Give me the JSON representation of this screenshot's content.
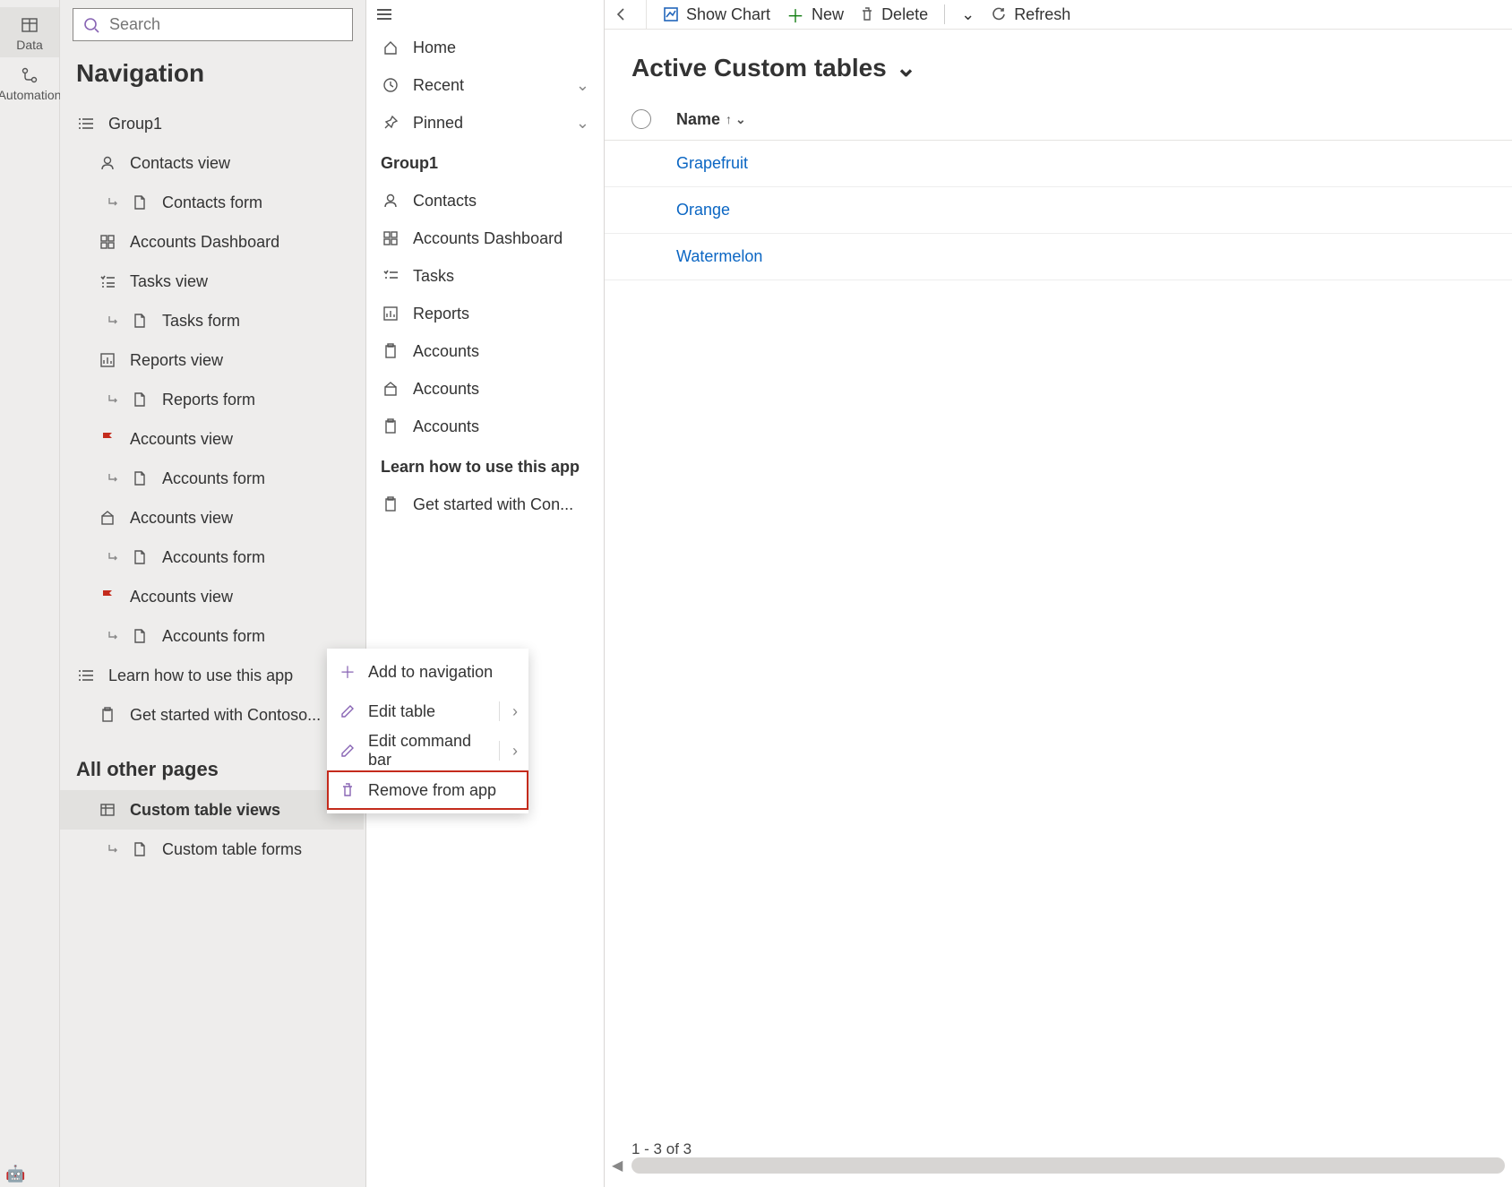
{
  "rail": {
    "data": "Data",
    "automation": "Automation"
  },
  "search": {
    "placeholder": "Search"
  },
  "nav": {
    "title": "Navigation",
    "group1": "Group1",
    "items": {
      "contacts_view": "Contacts view",
      "contacts_form": "Contacts form",
      "accounts_dashboard": "Accounts Dashboard",
      "tasks_view": "Tasks view",
      "tasks_form": "Tasks form",
      "reports_view": "Reports view",
      "reports_form": "Reports form",
      "accounts_view1": "Accounts view",
      "accounts_form1": "Accounts form",
      "accounts_view2": "Accounts view",
      "accounts_form2": "Accounts form",
      "accounts_view3": "Accounts view",
      "accounts_form3": "Accounts form"
    },
    "learn": "Learn how to use this app",
    "getstarted": "Get started with Contoso...",
    "all_other": "All other pages",
    "custom_views": "Custom table views",
    "custom_forms": "Custom table forms"
  },
  "mid": {
    "home": "Home",
    "recent": "Recent",
    "pinned": "Pinned",
    "group1": "Group1",
    "contacts": "Contacts",
    "accounts_dashboard": "Accounts Dashboard",
    "tasks": "Tasks",
    "reports": "Reports",
    "accounts1": "Accounts",
    "accounts2": "Accounts",
    "accounts3": "Accounts",
    "learn": "Learn how to use this app",
    "getstarted": "Get started with Con..."
  },
  "cmdbar": {
    "show_chart": "Show Chart",
    "new": "New",
    "delete": "Delete",
    "refresh": "Refresh"
  },
  "main": {
    "view_title": "Active Custom tables",
    "col_name": "Name",
    "rows": {
      "r0": "Grapefruit",
      "r1": "Orange",
      "r2": "Watermelon"
    },
    "footer": "1 - 3 of 3"
  },
  "ctx": {
    "add_nav": "Add to navigation",
    "edit_table": "Edit table",
    "edit_cmd": "Edit command bar",
    "remove": "Remove from app"
  }
}
